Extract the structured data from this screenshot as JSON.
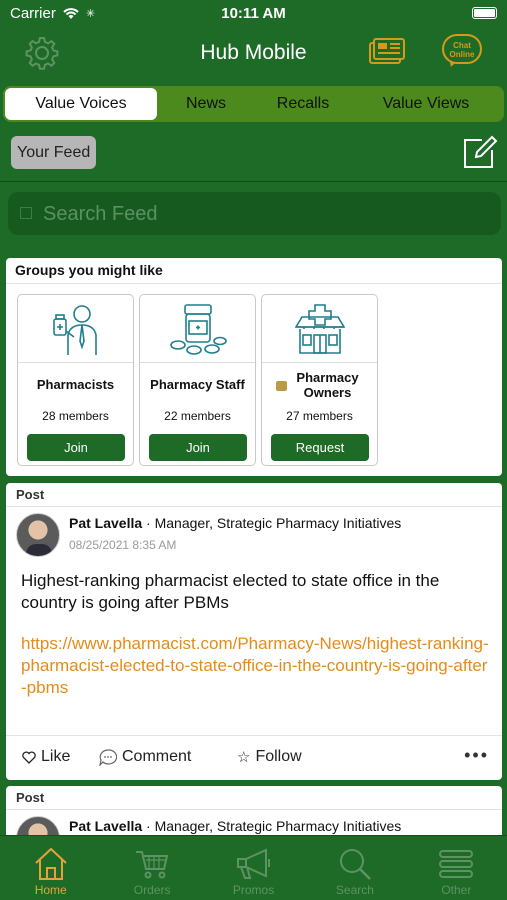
{
  "status_bar": {
    "carrier": "Carrier",
    "time": "10:11 AM"
  },
  "navbar": {
    "title": "Hub Mobile",
    "chat_label_1": "Chat",
    "chat_label_2": "Online"
  },
  "tabs": [
    {
      "label": "Value Voices",
      "active": true
    },
    {
      "label": "News"
    },
    {
      "label": "Recalls"
    },
    {
      "label": "Value Views"
    }
  ],
  "feed_button": "Your Feed",
  "search": {
    "placeholder": "Search Feed"
  },
  "groups": {
    "heading": "Groups you might like",
    "items": [
      {
        "name": "Pharmacists",
        "members": "28 members",
        "action": "Join",
        "icon": "pharmacist-icon"
      },
      {
        "name": "Pharmacy Staff",
        "members": "22 members",
        "action": "Join",
        "icon": "pill-bottle-icon"
      },
      {
        "name": "Pharmacy Owners",
        "members": "27 members",
        "action": "Request",
        "icon": "pharmacy-building-icon",
        "locked": true
      }
    ]
  },
  "posts": [
    {
      "label": "Post",
      "author": "Pat Lavella",
      "role": "Manager, Strategic Pharmacy Initiatives",
      "timestamp": "08/25/2021 8:35 AM",
      "text": "Highest-ranking pharmacist elected to state office in the country is going after PBMs",
      "link": "https://www.pharmacist.com/Pharmacy-News/highest-ranking-pharmacist-elected-to-state-office-in-the-country-is-going-after-pbms",
      "actions": {
        "like": "Like",
        "comment": "Comment",
        "follow": "Follow"
      }
    },
    {
      "label": "Post",
      "author": "Pat Lavella",
      "role": "Manager, Strategic Pharmacy Initiatives"
    }
  ],
  "tabbar": [
    {
      "label": "Home",
      "icon": "home-icon",
      "active": true
    },
    {
      "label": "Orders",
      "icon": "cart-icon"
    },
    {
      "label": "Promos",
      "icon": "megaphone-icon"
    },
    {
      "label": "Search",
      "icon": "search-icon"
    },
    {
      "label": "Other",
      "icon": "menu-icon"
    }
  ],
  "colors": {
    "brand_green": "#1e6b28",
    "tab_bar_green": "#4c8a1d",
    "accent_orange": "#e58b1c",
    "inactive_tab": "#5d9363"
  }
}
